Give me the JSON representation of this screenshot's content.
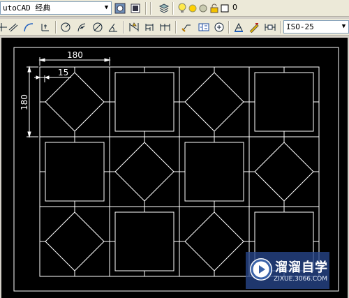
{
  "toolbar1": {
    "workspace_value": "utoCAD 经典",
    "layer_value": "0",
    "icons": [
      "workspace-settings-icon",
      "customize-icon",
      "layer-properties-icon",
      "lightbulb-icon",
      "sun-icon",
      "freeze-icon",
      "lock-icon",
      "color-swatch-icon"
    ]
  },
  "toolbar2": {
    "dimstyle_value": "ISO-25",
    "icons": [
      "linear-dimension-icon",
      "aligned-dimension-icon",
      "arc-length-icon",
      "ordinate-icon",
      "radius-icon",
      "jogged-icon",
      "diameter-icon",
      "angular-icon",
      "quick-dimension-icon",
      "baseline-icon",
      "continue-icon",
      "quick-leader-icon",
      "tolerance-icon",
      "center-mark-icon",
      "dimension-edit-icon",
      "dimension-text-edit-icon",
      "dimension-update-icon"
    ]
  },
  "drawing": {
    "dimensions": {
      "horizontal": "180",
      "vertical": "180",
      "offset": "15"
    },
    "background": "#000000",
    "line_color": "#ffffff"
  },
  "watermark": {
    "title": "溜溜自学",
    "url": "ZIXUE.3066.COM"
  }
}
